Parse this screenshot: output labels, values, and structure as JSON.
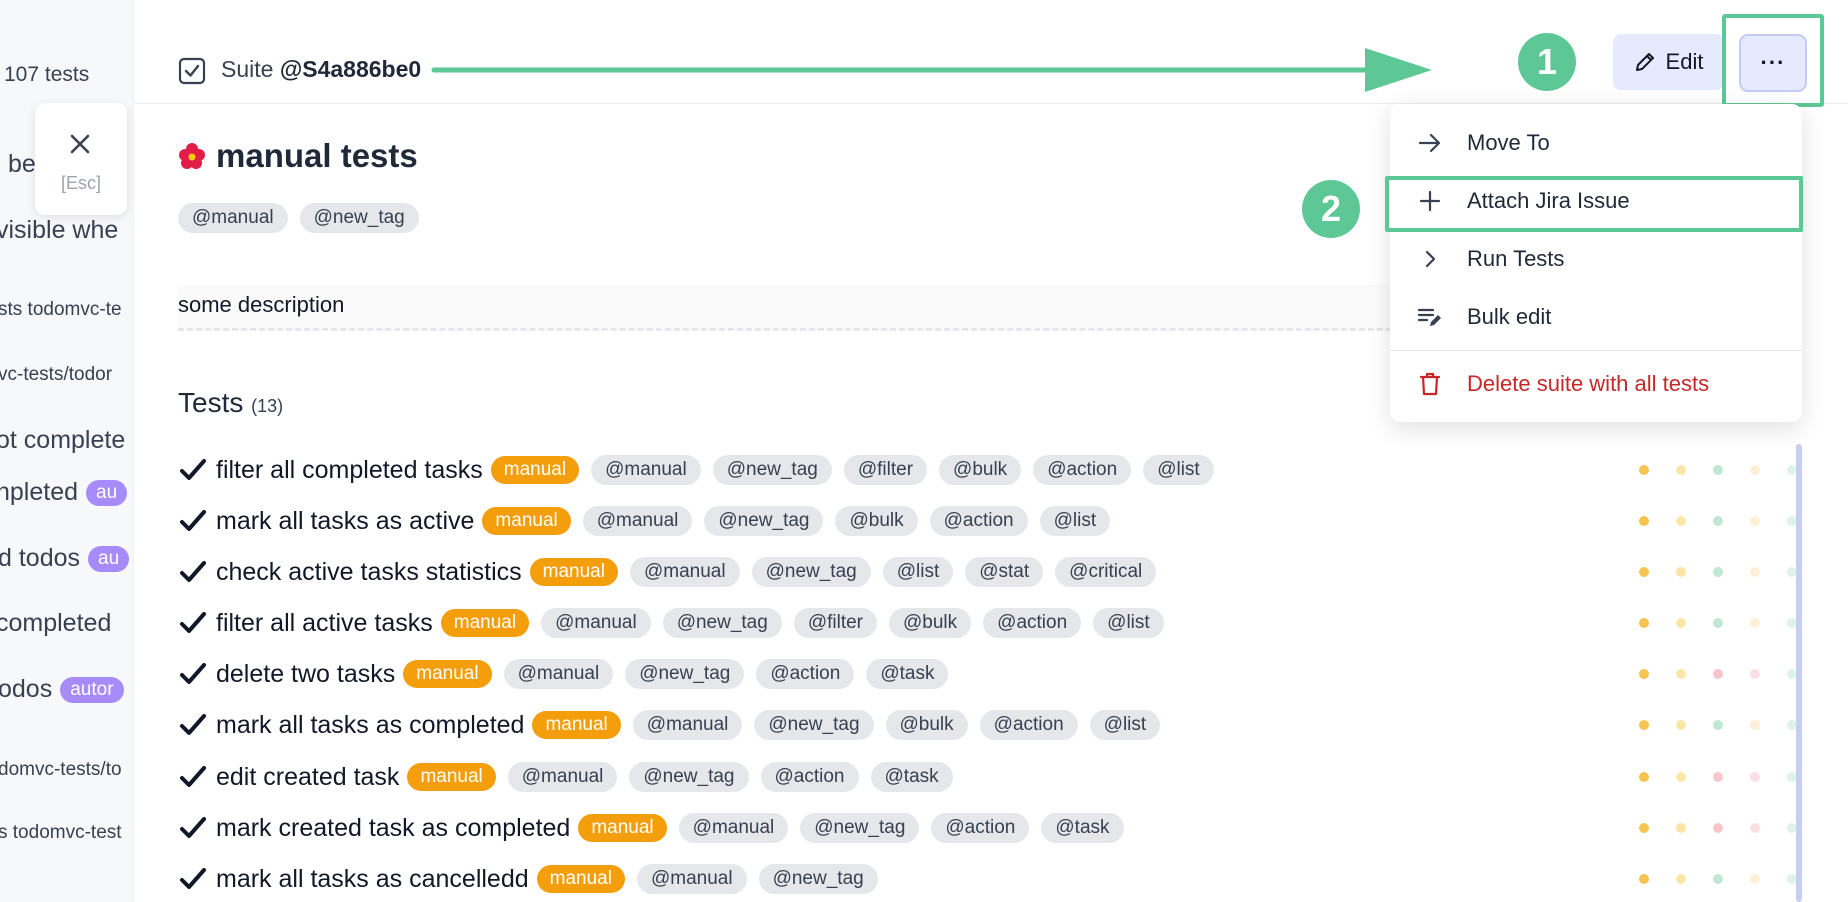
{
  "background_list": {
    "count_text": "107 tests",
    "items": [
      {
        "text": "be",
        "style": "big"
      },
      {
        "text": "visible whe",
        "style": "big"
      },
      {
        "text": "sts  todomvc-te",
        "style": "small"
      },
      {
        "text": "vc-tests/todor",
        "style": "small"
      },
      {
        "text": "ot complete",
        "style": "big"
      },
      {
        "text": "npleted",
        "style": "big",
        "chip": "au"
      },
      {
        "text": "d todos",
        "style": "big",
        "chip": "au"
      },
      {
        "text": "completed",
        "style": "big"
      },
      {
        "text": "odos",
        "style": "big",
        "chip": "autor"
      },
      {
        "text": "domvc-tests/to",
        "style": "small"
      },
      {
        "text": "s  todomvc-test",
        "style": "small"
      }
    ]
  },
  "close": {
    "esc_label": "[Esc]"
  },
  "header": {
    "suite_prefix": "Suite",
    "suite_id": "@S4a886be0",
    "edit_label": "Edit",
    "more_label": "···",
    "callout_1": "1",
    "callout_2": "2"
  },
  "suite": {
    "title": "manual tests",
    "tags": [
      "@manual",
      "@new_tag"
    ],
    "description": "some description"
  },
  "tests_section": {
    "heading": "Tests",
    "count": "(13)",
    "rows": [
      {
        "title": "filter all completed tasks",
        "chip": "manual",
        "tags": [
          "@manual",
          "@new_tag",
          "@filter",
          "@bulk",
          "@action",
          "@list"
        ],
        "dots": [
          "#f5c451",
          "#fbe6a8",
          "#bfe7d3",
          "#fdf0d6",
          "#dff3e9"
        ]
      },
      {
        "title": "mark all tasks as active",
        "chip": "manual",
        "tags": [
          "@manual",
          "@new_tag",
          "@bulk",
          "@action",
          "@list"
        ],
        "dots": [
          "#f5c451",
          "#fbe6a8",
          "#bfe7d3",
          "#fdf0d6",
          "#dff3e9"
        ]
      },
      {
        "title": "check active tasks statistics",
        "chip": "manual",
        "tags": [
          "@manual",
          "@new_tag",
          "@list",
          "@stat",
          "@critical"
        ],
        "dots": [
          "#f5c451",
          "#fbe6a8",
          "#bfe7d3",
          "#fdf0d6",
          "#dff3e9"
        ]
      },
      {
        "title": "filter all active tasks",
        "chip": "manual",
        "tags": [
          "@manual",
          "@new_tag",
          "@filter",
          "@bulk",
          "@action",
          "@list"
        ],
        "dots": [
          "#f5c451",
          "#fbe6a8",
          "#bfe7d3",
          "#fdf0d6",
          "#dff3e9"
        ]
      },
      {
        "title": "delete two tasks",
        "chip": "manual",
        "tags": [
          "@manual",
          "@new_tag",
          "@action",
          "@task"
        ],
        "dots": [
          "#f5c451",
          "#fbe6a8",
          "#f7c6cb",
          "#fbe0e3",
          "#dff3e9"
        ]
      },
      {
        "title": "mark all tasks as completed",
        "chip": "manual",
        "tags": [
          "@manual",
          "@new_tag",
          "@bulk",
          "@action",
          "@list"
        ],
        "dots": [
          "#f5c451",
          "#fbe6a8",
          "#bfe7d3",
          "#fdf0d6",
          "#dff3e9"
        ]
      },
      {
        "title": "edit created task",
        "chip": "manual",
        "tags": [
          "@manual",
          "@new_tag",
          "@action",
          "@task"
        ],
        "dots": [
          "#f5c451",
          "#fbe6a8",
          "#f7c6cb",
          "#fbe0e3",
          "#dff3e9"
        ]
      },
      {
        "title": "mark created task as completed",
        "chip": "manual",
        "tags": [
          "@manual",
          "@new_tag",
          "@action",
          "@task"
        ],
        "dots": [
          "#f5c451",
          "#fbe6a8",
          "#f7c6cb",
          "#fbe0e3",
          "#dff3e9"
        ]
      },
      {
        "title": "mark all tasks as cancelledd",
        "chip": "manual",
        "tags": [
          "@manual",
          "@new_tag"
        ],
        "dots": [
          "#f5c451",
          "#fbe6a8",
          "#bfe7d3",
          "#fdf0d6",
          "#dff3e9"
        ]
      }
    ]
  },
  "menu": {
    "items": [
      {
        "label": "Move To",
        "icon": "arrow-right-icon"
      },
      {
        "label": "Attach Jira Issue",
        "icon": "plus-icon"
      },
      {
        "label": "Run Tests",
        "icon": "chevron-right-icon"
      },
      {
        "label": "Bulk edit",
        "icon": "bulk-edit-icon"
      },
      {
        "label": "Delete suite with all tests",
        "icon": "trash-icon",
        "danger": true
      }
    ]
  },
  "colors": {
    "accent_green": "#5ec796",
    "manual_chip": "#f59e0b",
    "button_bg": "#e6eaff",
    "danger": "#c62828"
  }
}
